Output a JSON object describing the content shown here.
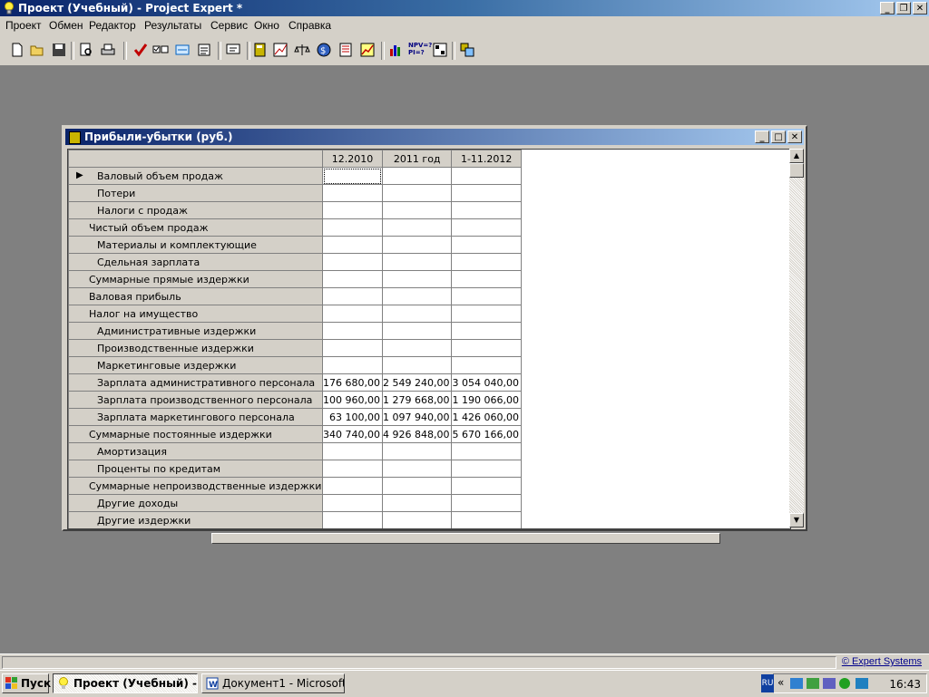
{
  "window": {
    "title": "Проект (Учебный) - Project Expert *"
  },
  "menu": [
    "Проект",
    "Обмен",
    "Редактор",
    "Результаты",
    "Сервис",
    "Окно",
    "Справка"
  ],
  "toolbar": {
    "icons": [
      "new-icon",
      "open-icon",
      "save-icon",
      "preview-icon",
      "print-icon",
      "check-icon",
      "checklist-icon",
      "exchange-icon",
      "notes-icon",
      "display-icon",
      "book-icon",
      "cashflow-icon",
      "balance-icon",
      "calculate-icon",
      "report-icon",
      "chart-icon",
      "bar-chart-icon",
      "npv-pi-icon",
      "analysis-icon",
      "tools-icon"
    ],
    "npv_label": "NPV=?",
    "pi_label": "PI=?"
  },
  "doc": {
    "title": "Прибыли-убытки (руб.)",
    "columns": [
      "12.2010",
      "2011 год",
      "1-11.2012"
    ],
    "rows": [
      {
        "label": "Валовый объем продаж",
        "level": 2,
        "values": [
          "",
          "",
          ""
        ],
        "current": true
      },
      {
        "label": "Потери",
        "level": 2,
        "values": [
          "",
          "",
          ""
        ]
      },
      {
        "label": "Налоги с продаж",
        "level": 2,
        "values": [
          "",
          "",
          ""
        ]
      },
      {
        "label": "Чистый объем продаж",
        "level": 1,
        "values": [
          "",
          "",
          ""
        ]
      },
      {
        "label": "Материалы и комплектующие",
        "level": 2,
        "values": [
          "",
          "",
          ""
        ]
      },
      {
        "label": "Сдельная зарплата",
        "level": 2,
        "values": [
          "",
          "",
          ""
        ]
      },
      {
        "label": "Суммарные прямые издержки",
        "level": 1,
        "values": [
          "",
          "",
          ""
        ]
      },
      {
        "label": "Валовая прибыль",
        "level": 1,
        "values": [
          "",
          "",
          ""
        ]
      },
      {
        "label": "Налог на имущество",
        "level": 1,
        "values": [
          "",
          "",
          ""
        ]
      },
      {
        "label": "Административные издержки",
        "level": 2,
        "values": [
          "",
          "",
          ""
        ]
      },
      {
        "label": "Производственные издержки",
        "level": 2,
        "values": [
          "",
          "",
          ""
        ]
      },
      {
        "label": "Маркетинговые издержки",
        "level": 2,
        "values": [
          "",
          "",
          ""
        ]
      },
      {
        "label": "Зарплата административного персонала",
        "level": 2,
        "values": [
          "176 680,00",
          "2 549 240,00",
          "3 054 040,00"
        ]
      },
      {
        "label": "Зарплата производственного персонала",
        "level": 2,
        "values": [
          "100 960,00",
          "1 279 668,00",
          "1 190 066,00"
        ]
      },
      {
        "label": "Зарплата маркетингового персонала",
        "level": 2,
        "values": [
          "63 100,00",
          "1 097 940,00",
          "1 426 060,00"
        ]
      },
      {
        "label": "Суммарные постоянные издержки",
        "level": 1,
        "values": [
          "340 740,00",
          "4 926 848,00",
          "5 670 166,00"
        ]
      },
      {
        "label": "Амортизация",
        "level": 2,
        "values": [
          "",
          "",
          ""
        ]
      },
      {
        "label": "Проценты по кредитам",
        "level": 2,
        "values": [
          "",
          "",
          ""
        ]
      },
      {
        "label": "Суммарные непроизводственные издержки",
        "level": 1,
        "values": [
          "",
          "",
          ""
        ]
      },
      {
        "label": "Другие доходы",
        "level": 2,
        "values": [
          "",
          "",
          ""
        ]
      },
      {
        "label": "Другие издержки",
        "level": 2,
        "values": [
          "",
          "",
          ""
        ]
      }
    ]
  },
  "status": {
    "link": "© Expert Systems"
  },
  "taskbar": {
    "start": "Пуск",
    "tasks": [
      "Проект (Учебный) - ...",
      "Документ1 - Microsoft ..."
    ],
    "lang": "RU",
    "clock": "16:43"
  }
}
